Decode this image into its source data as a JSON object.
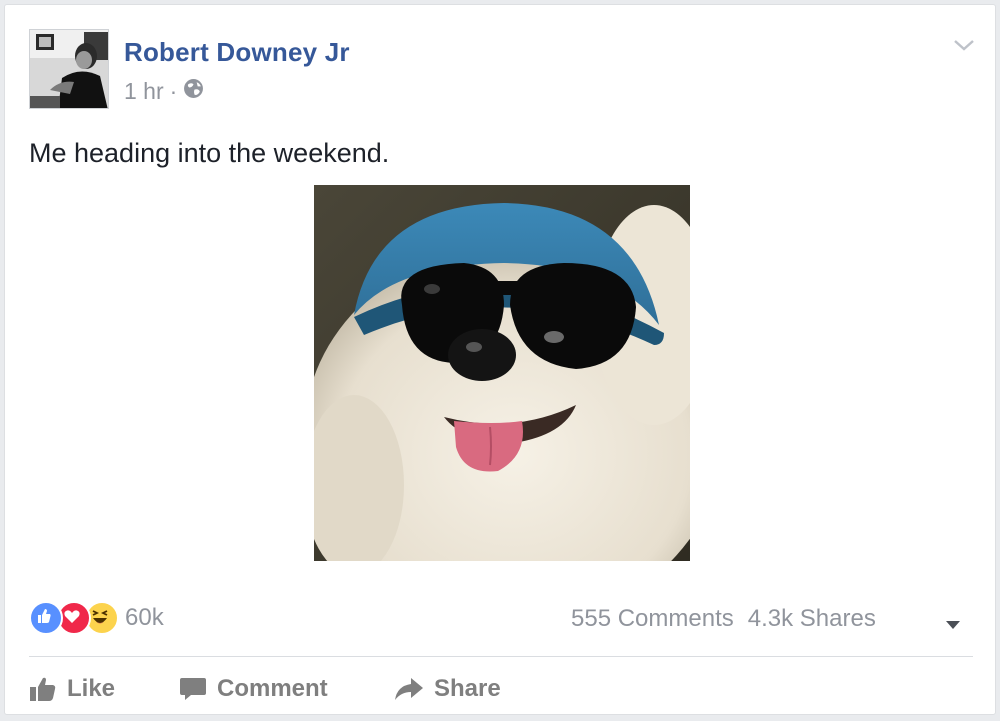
{
  "post": {
    "author": "Robert Downey Jr",
    "time": "1 hr",
    "separator": "·",
    "privacy_icon": "globe-icon",
    "text": "Me heading into the weekend."
  },
  "engagement": {
    "reaction_icons": [
      "like-reaction-icon",
      "love-reaction-icon",
      "haha-reaction-icon"
    ],
    "reaction_count": "60k",
    "comments": "555 Comments",
    "shares": "4.3k Shares"
  },
  "actions": {
    "like_label": "Like",
    "comment_label": "Comment",
    "share_label": "Share"
  },
  "colors": {
    "author_link": "#365899",
    "muted_text": "#90949c",
    "like_blue": "#5890ff",
    "love_red": "#f0284a",
    "haha_yellow": "#fcd34d"
  }
}
